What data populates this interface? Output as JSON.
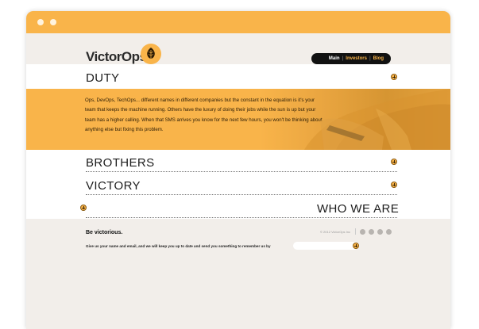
{
  "brand": {
    "name": "VictorOps"
  },
  "nav": {
    "items": [
      "Main",
      "Investors",
      "Blog"
    ]
  },
  "sections": {
    "duty": "DUTY",
    "duty_text": "Ops, DevOps, TechOps... different names in different companies but the constant in the equation is it's your team that keeps the machine running.  Others have the luxury of doing their jobs while the sun is up but your team has a higher calling. When that SMS arrives you know for the next few hours, you won't be thinking about anything else but fixing this problem.",
    "brothers": "BROTHERS",
    "victory": "VICTORY",
    "who_we_are": "WHO WE ARE"
  },
  "footer": {
    "tagline": "Be victorious.",
    "copyright": "© 2012 VictorOps Inc",
    "signup_label": "Give us your name and email, and we will keep you up to date and send you something to remember us by",
    "social_icons": [
      "linkedin-icon",
      "google-plus-icon",
      "facebook-icon",
      "email-icon"
    ]
  },
  "colors": {
    "accent": "#f9b44a",
    "background": "#f2eeea",
    "dark": "#111111"
  }
}
